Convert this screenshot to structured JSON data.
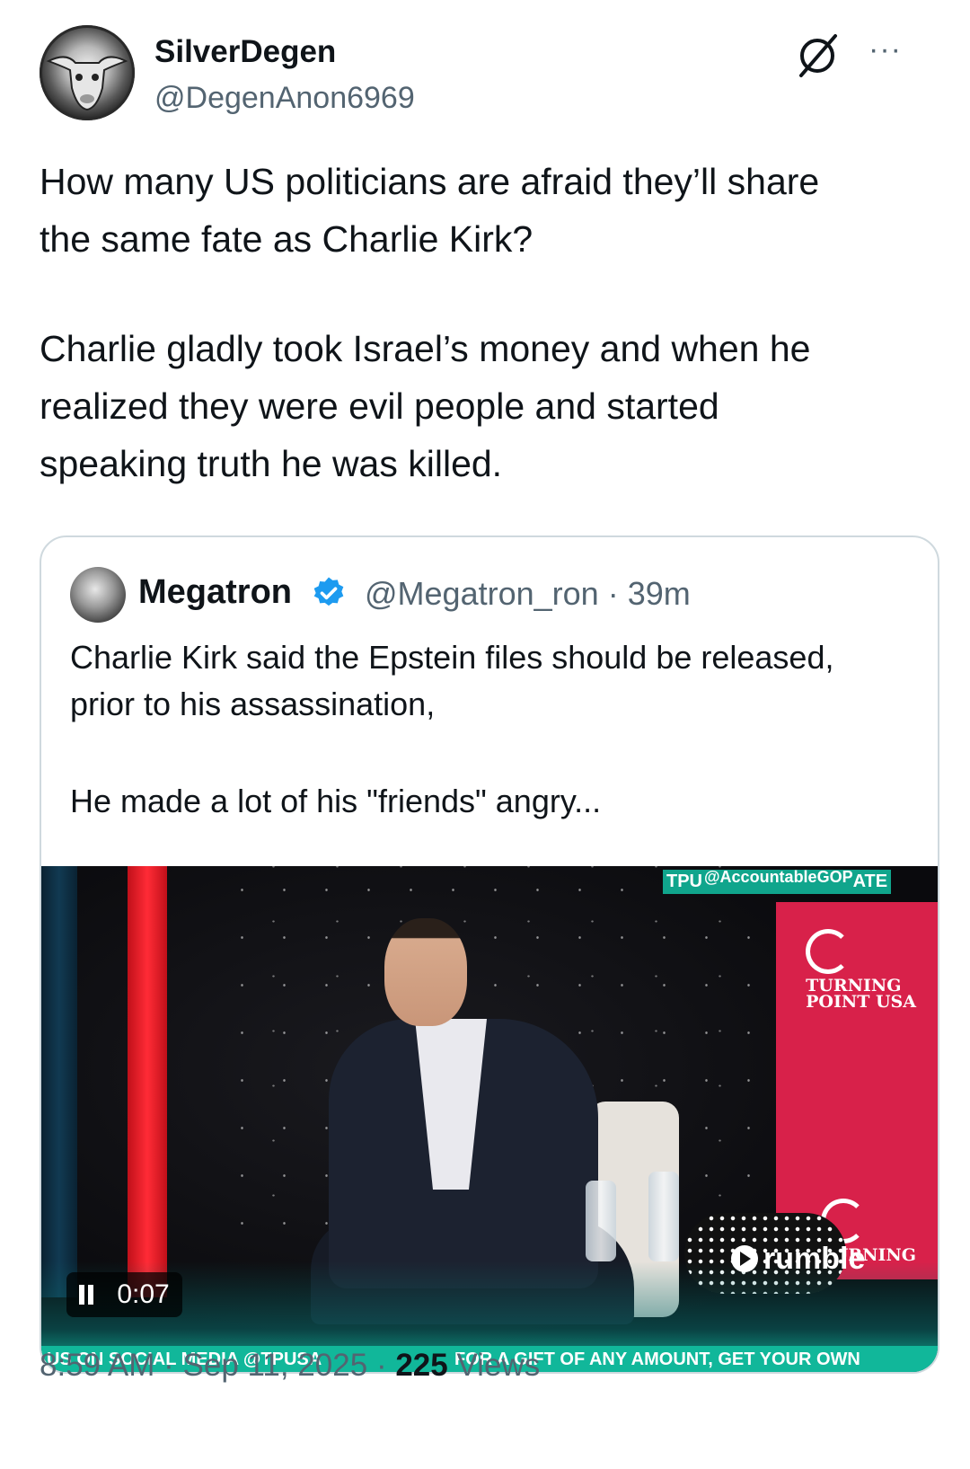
{
  "author": {
    "display_name": "SilverDegen",
    "handle": "@DegenAnon6969",
    "avatar": "bull-skull-avatar"
  },
  "header_icons": [
    "grok-icon",
    "more-icon"
  ],
  "more_label": "···",
  "tweet": {
    "paragraph_1": "How many US politicians are afraid they’ll share\nthe same fate as Charlie Kirk?",
    "paragraph_2": "Charlie gladly took Israel’s money and when he\nrealized they were evil people and started\nspeaking truth he was killed."
  },
  "quote": {
    "display_name": "Megatron",
    "verified": true,
    "handle": "@Megatron_ron",
    "separator": "·",
    "time": "39m",
    "paragraph_1": "Charlie Kirk said the Epstein files should be released, prior to his assassination,",
    "paragraph_2": "He made a lot of his \"friends\" angry..."
  },
  "video": {
    "elapsed": "0:07",
    "watermark_top_left": "TPU",
    "watermark_account": "@AccountableGOP",
    "watermark_top_right": "ATE",
    "rumble_label": "rumble",
    "ticker_left": "US ON SOCIAL MEDIA @TPUSA",
    "ticker_right": "FOR A GIFT OF ANY AMOUNT, GET YOUR OWN",
    "logo_text_1": "TURNING\nPOINT USA",
    "logo_text_2": "TURNING",
    "accent_red": "#ff2b36",
    "accent_teal": "#11b79a"
  },
  "footer": {
    "time": "8:59 AM",
    "date": "Sep 11, 2025",
    "separator": "·",
    "views_count": "225",
    "views_label": "Views"
  },
  "colors": {
    "text": "#0f1419",
    "secondary": "#536471",
    "border": "#cfd9de",
    "verified_blue": "#1d9bf0"
  }
}
